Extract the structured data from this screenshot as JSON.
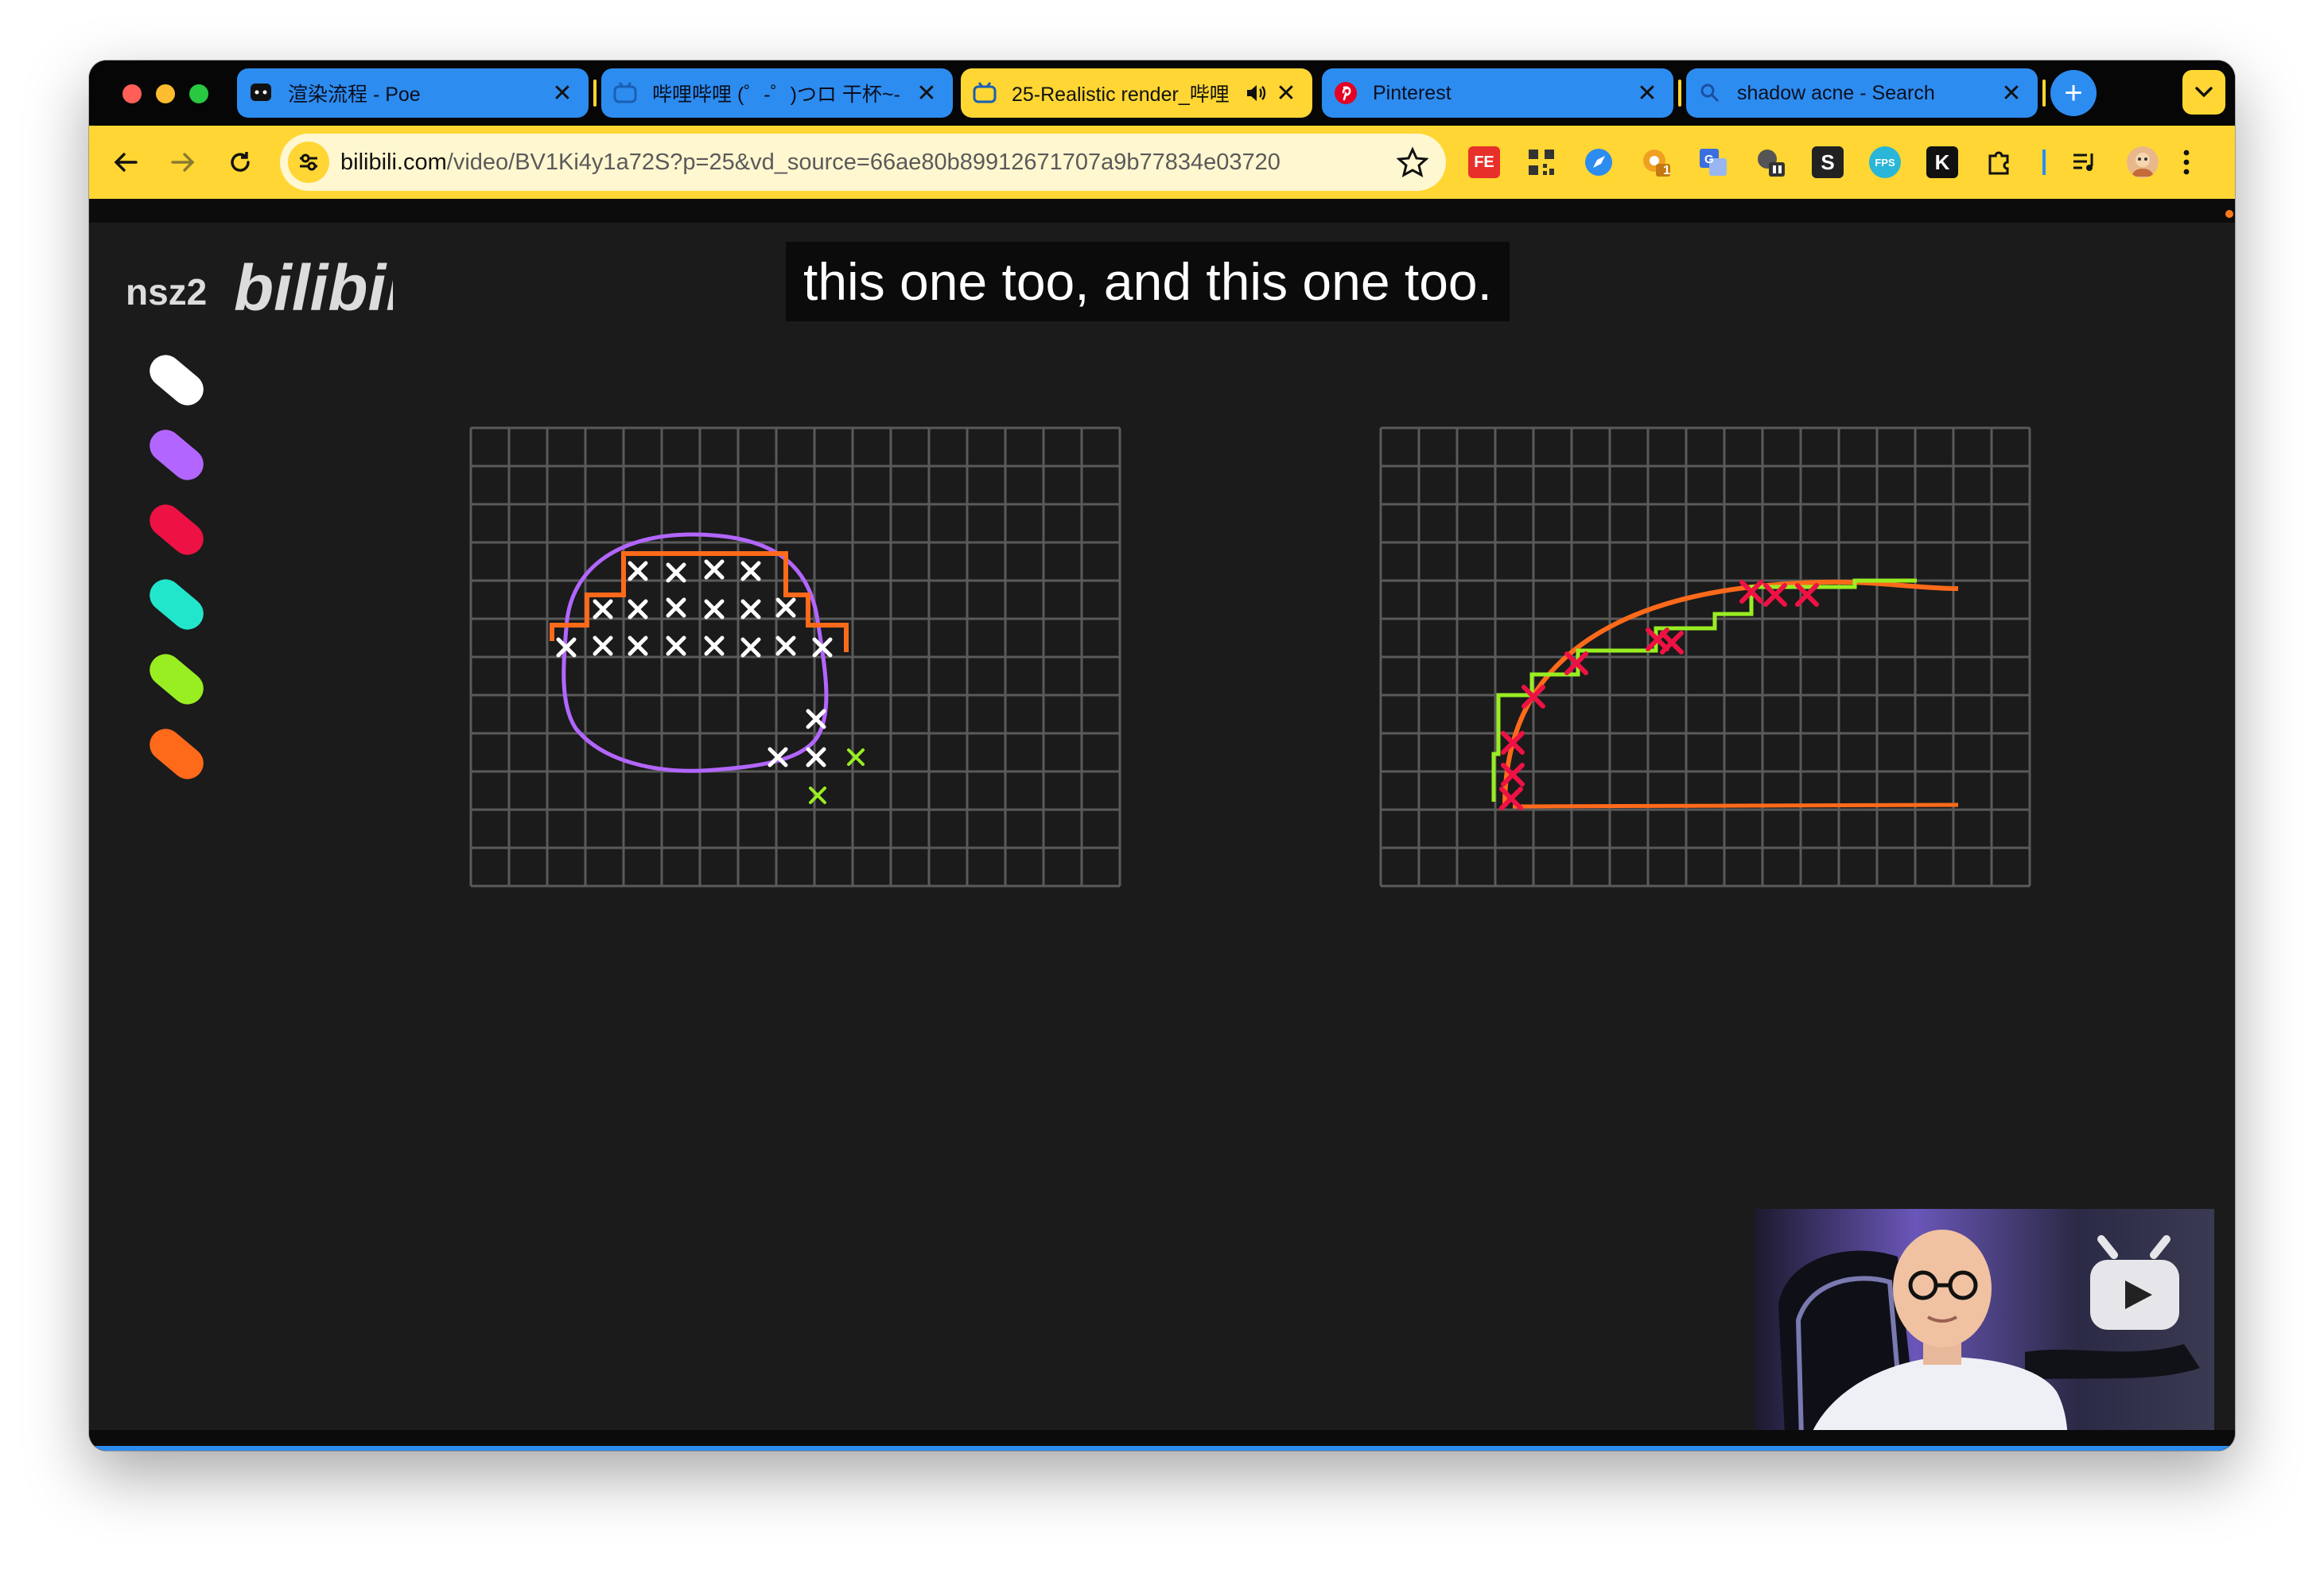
{
  "browser": {
    "tabs": [
      {
        "title": "渲染流程 - Poe",
        "icon": "poe-icon",
        "active": false
      },
      {
        "title": "哔哩哔哩 (゜-゜)つロ 干杯~-",
        "icon": "bilibili-tv-icon",
        "active": false
      },
      {
        "title": "25-Realistic render_哔哩",
        "icon": "bilibili-tv-icon",
        "active": true,
        "audio": true
      },
      {
        "title": "Pinterest",
        "icon": "pinterest-icon",
        "active": false
      },
      {
        "title": "shadow acne - Search",
        "icon": "search-icon",
        "active": false
      }
    ],
    "tab_close_glyph": "✕",
    "new_tab_glyph": "+",
    "address": {
      "domain": "bilibili.com",
      "path": "/video/BV1Ki4y1a72S?p=25&vd_source=66ae80b89912671707a9b77834e03720"
    },
    "extensions": [
      {
        "name": "fe-extension-icon",
        "label": "FE",
        "color": "#e8302a"
      },
      {
        "name": "qr-code-extension-icon",
        "label": "",
        "color": "#333333"
      },
      {
        "name": "compass-extension-icon",
        "label": "",
        "color": "#2d8cf0"
      },
      {
        "name": "chrome-badge-extension-icon",
        "label": "1",
        "color": "#f0a020"
      },
      {
        "name": "translate-extension-icon",
        "label": "G",
        "color": "#3b6fe0"
      },
      {
        "name": "octocat-extension-icon",
        "label": "",
        "color": "#444444"
      },
      {
        "name": "s-extension-icon",
        "label": "S",
        "color": "#222222"
      },
      {
        "name": "fps-extension-icon",
        "label": "FPS",
        "color": "#29b6d8"
      },
      {
        "name": "k-extension-icon",
        "label": "K",
        "color": "#111111"
      },
      {
        "name": "puzzle-extension-icon",
        "label": "",
        "color": "#111111"
      }
    ]
  },
  "video": {
    "subtitle": "this one too, and this one too.",
    "uploader": "nsz2",
    "watermark": "bilibili",
    "palette_colors": [
      "#ffffff",
      "#b266ff",
      "#ee1144",
      "#22e6cc",
      "#99ee22",
      "#ff6a1a"
    ],
    "accent": "#2d8cf0"
  }
}
